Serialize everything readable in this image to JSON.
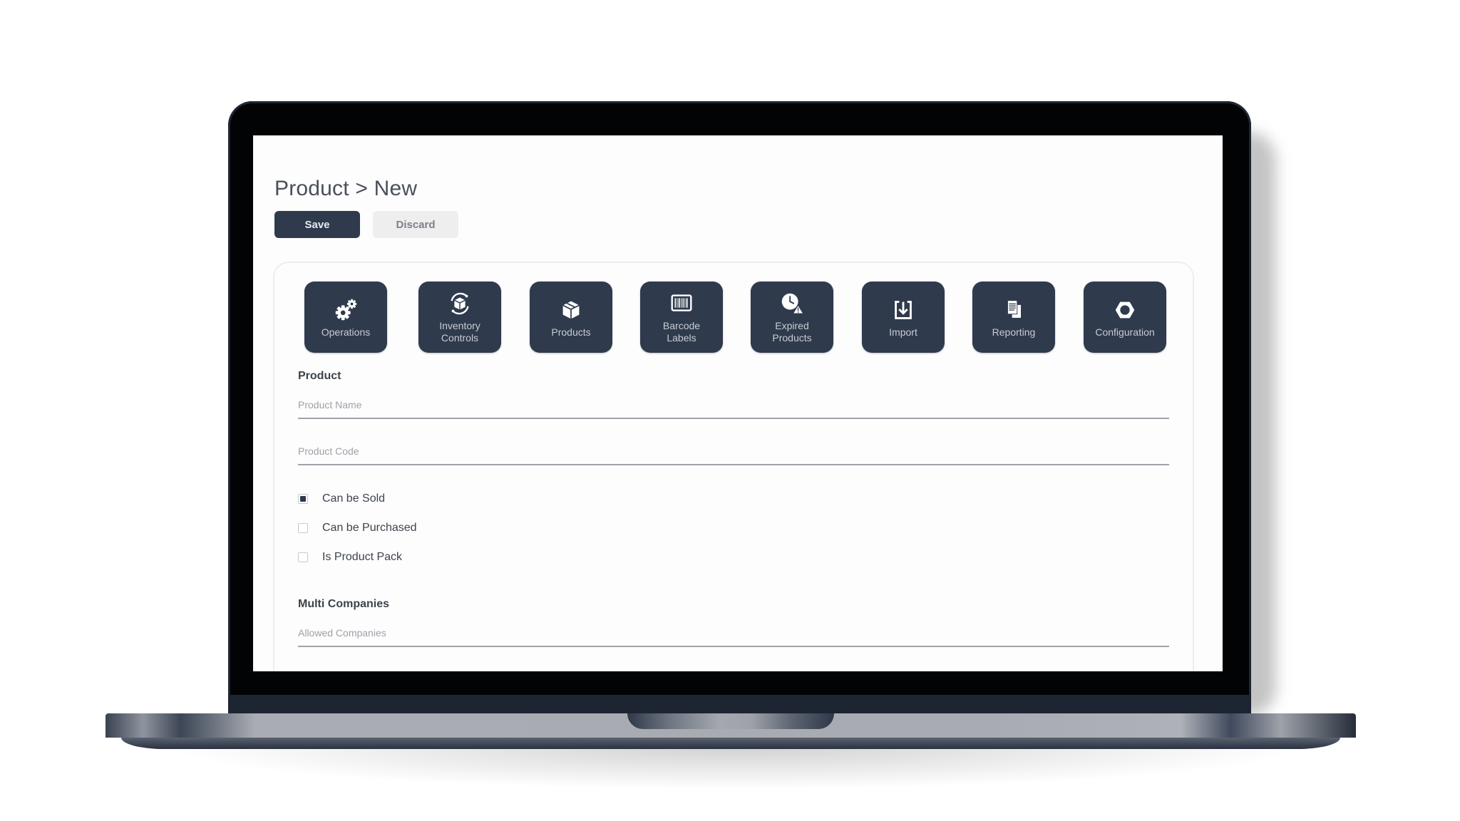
{
  "page": {
    "title": "Product > New"
  },
  "toolbar": {
    "save_label": "Save",
    "discard_label": "Discard"
  },
  "tiles": [
    {
      "id": "operations",
      "label": "Operations",
      "icon": "gears-icon"
    },
    {
      "id": "inventory-controls",
      "label": "Inventory\nControls",
      "icon": "inventory-cycle-icon"
    },
    {
      "id": "products",
      "label": "Products",
      "icon": "box-icon"
    },
    {
      "id": "barcode-labels",
      "label": "Barcode\nLabels",
      "icon": "barcode-icon"
    },
    {
      "id": "expired-products",
      "label": "Expired\nProducts",
      "icon": "clock-warning-icon"
    },
    {
      "id": "import",
      "label": "Import",
      "icon": "import-icon"
    },
    {
      "id": "reporting",
      "label": "Reporting",
      "icon": "documents-icon"
    },
    {
      "id": "configuration",
      "label": "Configuration",
      "icon": "hex-nut-icon"
    }
  ],
  "form": {
    "product_section": "Product",
    "product_name": {
      "value": "",
      "placeholder": "Product Name"
    },
    "product_code": {
      "value": "",
      "placeholder": "Product Code"
    },
    "checkboxes": [
      {
        "label": "Can be Sold",
        "checked": true
      },
      {
        "label": "Can be Purchased",
        "checked": false
      },
      {
        "label": "Is Product Pack",
        "checked": false
      }
    ],
    "multi_companies_section": "Multi Companies",
    "allowed_companies": {
      "value": "",
      "placeholder": "Allowed Companies"
    }
  },
  "colors": {
    "primary": "#2f3a4d",
    "tile_text": "#c9ccd2",
    "secondary_button": "#eeeeee",
    "text": "#3d434d"
  }
}
